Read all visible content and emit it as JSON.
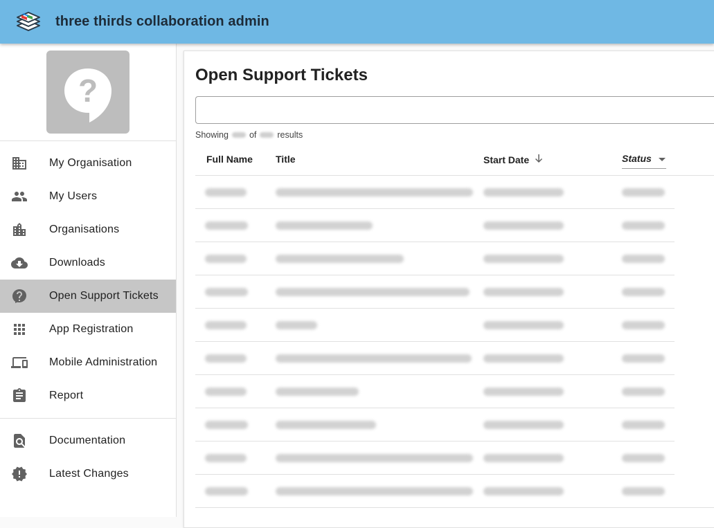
{
  "app": {
    "title": "three thirds collaboration admin",
    "logo_icon": "stacked-books-logo",
    "bar_color": "#6fb8e4"
  },
  "sidebar": {
    "items": [
      {
        "label": "My Organisation",
        "icon": "building-icon",
        "active": false
      },
      {
        "label": "My Users",
        "icon": "people-icon",
        "active": false
      },
      {
        "label": "Organisations",
        "icon": "buildings-icon",
        "active": false
      },
      {
        "label": "Downloads",
        "icon": "cloud-download-icon",
        "active": false
      },
      {
        "label": "Open Support Tickets",
        "icon": "help-circle-icon",
        "active": true
      },
      {
        "label": "App Registration",
        "icon": "apps-grid-icon",
        "active": false
      },
      {
        "label": "Mobile Administration",
        "icon": "devices-icon",
        "active": false
      },
      {
        "label": "Report",
        "icon": "clipboard-icon",
        "active": false
      }
    ],
    "secondary_items": [
      {
        "label": "Documentation",
        "icon": "document-search-icon"
      },
      {
        "label": "Latest Changes",
        "icon": "new-releases-icon"
      }
    ]
  },
  "main": {
    "title": "Open Support Tickets",
    "search": {
      "value": "",
      "placeholder": ""
    },
    "results": {
      "prefix": "Showing",
      "middle": "of",
      "suffix": "results"
    },
    "table": {
      "columns": [
        "Full Name",
        "Title",
        "Start Date",
        "Status"
      ],
      "sort_column": "Start Date",
      "sort_direction": "descending",
      "row_count": 10
    }
  }
}
